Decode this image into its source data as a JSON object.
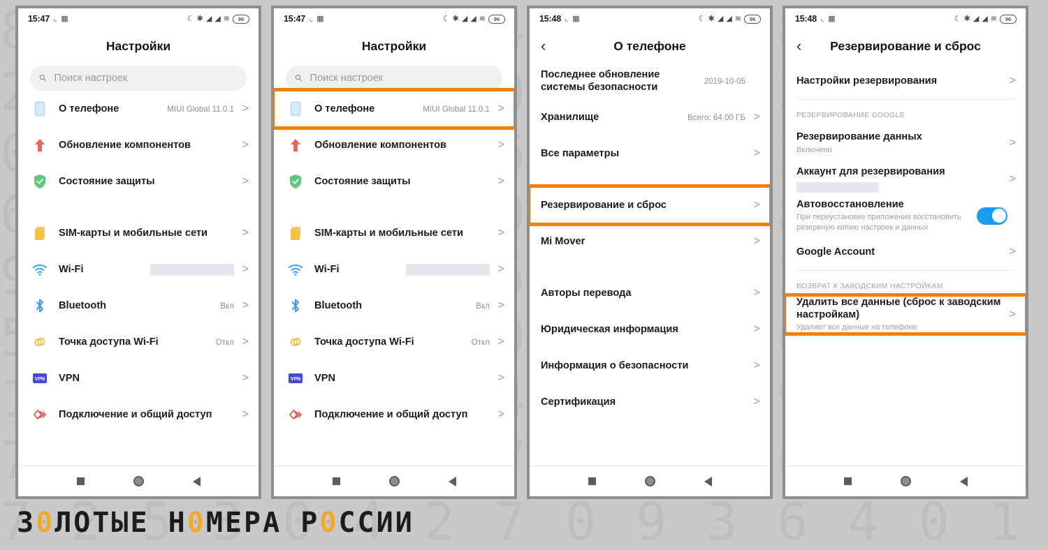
{
  "background": {
    "color": "#c8c9c8",
    "digit_rows": [
      "8 1 0 1 9 3 6 4 0 1 5 8 3 9 4 6 1 8 7 2",
      "2 7 0 9 3 6 4 0 1 5 8 3 9 4 6 1 8 7 2 5",
      "0 1 5 8 3 9 4 6 1 8 7 2 5 3 0 4 2 7 0 9",
      "6 4 0 1 5 8 3 9 4 6 1 8 7 2 5 3 0 4 2 7",
      "9 4 6 1 8 7 2 5 3 0 4 2 7 0 9 3 6 4 0 1",
      "5 3 0 4 2 7 0 9 3 6 4 0 1 5 8 3 9 4 6 1",
      "1 8 7 2 5 3 0 4 2 7 0 9 3 6 4 0 1 5 8 3",
      "7 2 5 3 0 4 2 7 0 9 3 6 4 0 1 5 8 3 9 4",
      "7 2 5 3 0 4 2 7 0 9 3 6 4 0 1 5 8 3 9 4"
    ]
  },
  "watermark": {
    "parts": [
      {
        "t": "З",
        "accent": false
      },
      {
        "t": "0",
        "accent": true
      },
      {
        "t": "ЛОТЫЕ Н",
        "accent": false
      },
      {
        "t": "0",
        "accent": true
      },
      {
        "t": "МЕРА Р",
        "accent": false
      },
      {
        "t": "0",
        "accent": true
      },
      {
        "t": "ССИИ",
        "accent": false
      }
    ],
    "full_text": "З0ЛОТЫЕ Н0МЕРА Р0ССИИ",
    "accent_color": "#f0a82e"
  },
  "highlight_color": "#f2800d",
  "toggle_on_color": "#1b9cf0",
  "statusbar_common": {
    "icons": [
      "dnd-icon",
      "bluetooth-icon",
      "signal-bar-icon",
      "signal-bar-2-icon",
      "wifi-icon"
    ],
    "battery_label": "96"
  },
  "navbar": {
    "recents_label": "recents-button",
    "home_label": "home-button",
    "back_label": "back-button"
  },
  "panels": [
    {
      "id": "settings-main",
      "status_time": "15:47",
      "title": "Настройки",
      "has_back": false,
      "search": {
        "placeholder": "Поиск настроек"
      },
      "rows": [
        {
          "type": "item",
          "icon": "phone-icon",
          "icon_color": "#b3d9f0",
          "label": "О телефоне",
          "value": "MIUI Global 11.0.1",
          "chevron": ">",
          "highlight": false
        },
        {
          "type": "item",
          "icon": "arrow-up-icon",
          "icon_color": "#e1695f",
          "label": "Обновление компонентов",
          "value": "",
          "chevron": ">",
          "highlight": false
        },
        {
          "type": "item",
          "icon": "shield-check-icon",
          "icon_color": "#5cc97e",
          "label": "Состояние защиты",
          "value": "",
          "chevron": ">",
          "highlight": false
        },
        {
          "type": "gap"
        },
        {
          "type": "item",
          "icon": "sim-card-icon",
          "icon_color": "#f3c048",
          "label": "SIM-карты и мобильные сети",
          "value": "",
          "chevron": ">",
          "highlight": false
        },
        {
          "type": "item",
          "icon": "wifi-icon",
          "icon_color": "#4da3e8",
          "label": "Wi-Fi",
          "value": "",
          "redacted": true,
          "chevron": ">",
          "highlight": false
        },
        {
          "type": "item",
          "icon": "bluetooth-icon",
          "icon_color": "#3d9ae8",
          "label": "Bluetooth",
          "value": "Вкл",
          "chevron": ">",
          "highlight": false
        },
        {
          "type": "item",
          "icon": "hotspot-icon",
          "icon_color": "#e8c452",
          "label": "Точка доступа Wi-Fi",
          "value": "Откл",
          "chevron": ">",
          "highlight": false
        },
        {
          "type": "item",
          "icon": "vpn-icon",
          "icon_color": "#4848d8",
          "label": "VPN",
          "value": "",
          "chevron": ">",
          "highlight": false
        },
        {
          "type": "item",
          "icon": "share-connection-icon",
          "icon_color": "#e0574d",
          "label": "Подключение и общий доступ",
          "value": "",
          "chevron": ">",
          "highlight": false
        }
      ]
    },
    {
      "id": "settings-main-highlighted",
      "status_time": "15:47",
      "title": "Настройки",
      "has_back": false,
      "search": {
        "placeholder": "Поиск настроек"
      },
      "rows": [
        {
          "type": "item",
          "icon": "phone-icon",
          "icon_color": "#b3d9f0",
          "label": "О телефоне",
          "value": "MIUI Global 11.0.1",
          "chevron": ">",
          "highlight": true
        },
        {
          "type": "item",
          "icon": "arrow-up-icon",
          "icon_color": "#e1695f",
          "label": "Обновление компонентов",
          "value": "",
          "chevron": ">",
          "highlight": false
        },
        {
          "type": "item",
          "icon": "shield-check-icon",
          "icon_color": "#5cc97e",
          "label": "Состояние защиты",
          "value": "",
          "chevron": ">",
          "highlight": false
        },
        {
          "type": "gap"
        },
        {
          "type": "item",
          "icon": "sim-card-icon",
          "icon_color": "#f3c048",
          "label": "SIM-карты и мобильные сети",
          "value": "",
          "chevron": ">",
          "highlight": false
        },
        {
          "type": "item",
          "icon": "wifi-icon",
          "icon_color": "#4da3e8",
          "label": "Wi-Fi",
          "value": "",
          "redacted": true,
          "chevron": ">",
          "highlight": false
        },
        {
          "type": "item",
          "icon": "bluetooth-icon",
          "icon_color": "#3d9ae8",
          "label": "Bluetooth",
          "value": "Вкл",
          "chevron": ">",
          "highlight": false
        },
        {
          "type": "item",
          "icon": "hotspot-icon",
          "icon_color": "#e8c452",
          "label": "Точка доступа Wi-Fi",
          "value": "Откл",
          "chevron": ">",
          "highlight": false
        },
        {
          "type": "item",
          "icon": "vpn-icon",
          "icon_color": "#4848d8",
          "label": "VPN",
          "value": "",
          "chevron": ">",
          "highlight": false
        },
        {
          "type": "item",
          "icon": "share-connection-icon",
          "icon_color": "#e0574d",
          "label": "Подключение и общий доступ",
          "value": "",
          "chevron": ">",
          "highlight": false
        }
      ]
    },
    {
      "id": "about-phone",
      "status_time": "15:48",
      "title": "О телефоне",
      "has_back": true,
      "search": null,
      "rows": [
        {
          "type": "item",
          "label": "Последнее обновление системы безопасности",
          "value": "2019-10-05",
          "chevron": "",
          "highlight": false
        },
        {
          "type": "item",
          "label": "Хранилище",
          "value": "Всего: 64,00 ГБ",
          "chevron": ">",
          "highlight": false
        },
        {
          "type": "item",
          "label": "Все параметры",
          "value": "",
          "chevron": ">",
          "highlight": false
        },
        {
          "type": "gap"
        },
        {
          "type": "item",
          "label": "Резервирование и сброс",
          "value": "",
          "chevron": ">",
          "highlight": true
        },
        {
          "type": "item",
          "label": "Mi Mover",
          "value": "",
          "chevron": ">",
          "highlight": false
        },
        {
          "type": "gap"
        },
        {
          "type": "item",
          "label": "Авторы перевода",
          "value": "",
          "chevron": ">",
          "highlight": false
        },
        {
          "type": "item",
          "label": "Юридическая информация",
          "value": "",
          "chevron": ">",
          "highlight": false
        },
        {
          "type": "item",
          "label": "Информация о безопасности",
          "value": "",
          "chevron": ">",
          "highlight": false
        },
        {
          "type": "item",
          "label": "Сертификация",
          "value": "",
          "chevron": ">",
          "highlight": false
        }
      ]
    },
    {
      "id": "backup-and-reset",
      "status_time": "15:48",
      "title": "Резервирование и сброс",
      "has_back": true,
      "search": null,
      "rows": [
        {
          "type": "item",
          "label": "Настройки резервирования",
          "value": "",
          "chevron": ">",
          "highlight": false
        },
        {
          "type": "divider"
        },
        {
          "type": "section",
          "label": "РЕЗЕРВИРОВАНИЕ GOOGLE"
        },
        {
          "type": "item",
          "label": "Резервирование данных",
          "sub": "Включено",
          "value": "",
          "chevron": ">",
          "highlight": false
        },
        {
          "type": "item",
          "label": "Аккаунт для резервирования",
          "sub_redacted": true,
          "value": "",
          "chevron": ">",
          "highlight": false
        },
        {
          "type": "item",
          "label": "Автовосстановление",
          "sub": "При переустановке приложения восстановить резервную копию настроек и данных",
          "toggle": true,
          "toggle_on": true,
          "chevron": "",
          "highlight": false
        },
        {
          "type": "item",
          "label": "Google Account",
          "value": "",
          "chevron": ">",
          "highlight": false
        },
        {
          "type": "divider"
        },
        {
          "type": "section",
          "label": "ВОЗВРАТ К ЗАВОДСКИМ НАСТРОЙКАМ"
        },
        {
          "type": "item",
          "label": "Удалить все данные (сброс к заводским настройкам)",
          "sub": "Удаляет все данные на телефоне",
          "value": "",
          "chevron": ">",
          "highlight": true
        }
      ]
    }
  ]
}
